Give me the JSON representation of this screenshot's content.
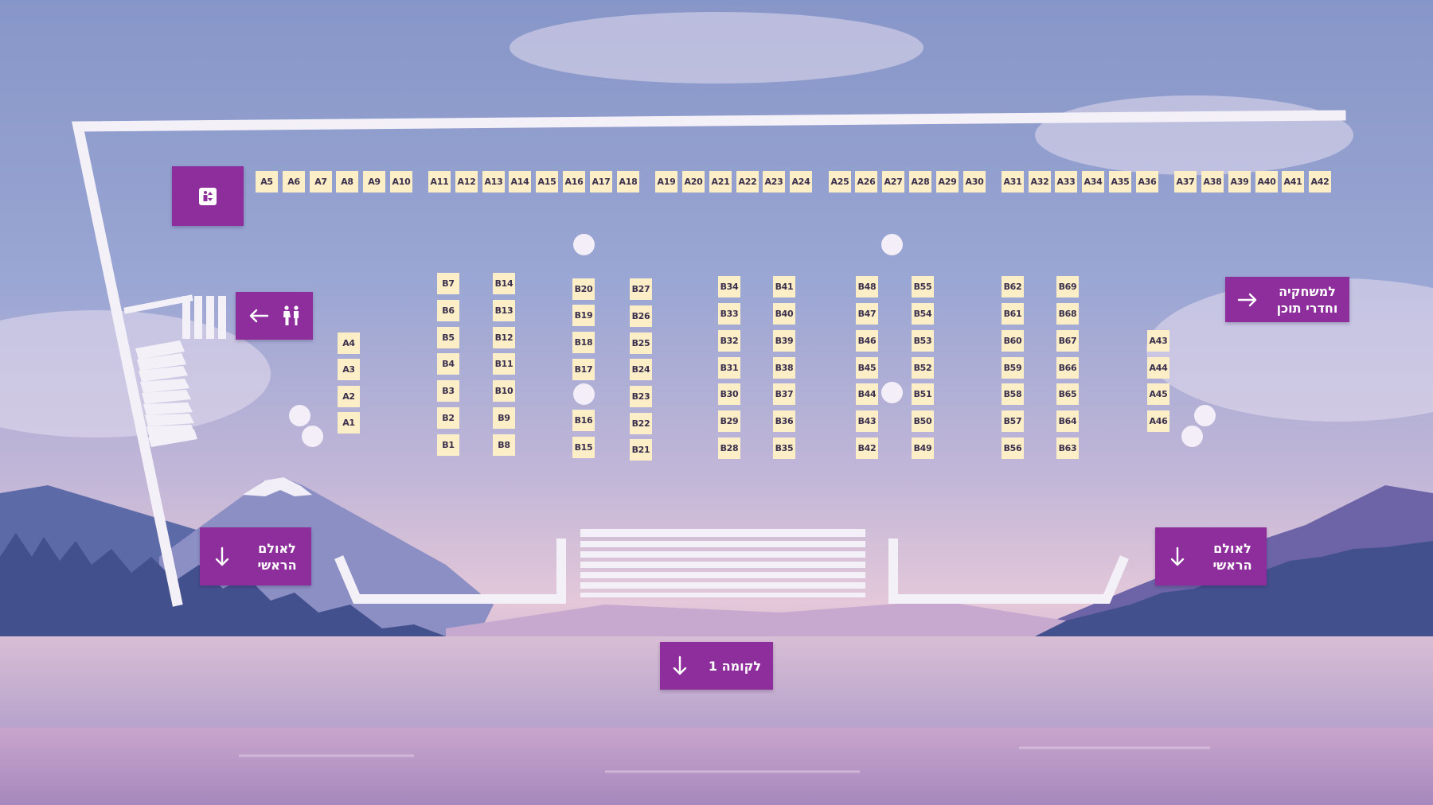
{
  "map": {
    "booths_row_a_top": [
      "A5",
      "A6",
      "A7",
      "A8",
      "A9",
      "A10",
      "A11",
      "A12",
      "A13",
      "A14",
      "A15",
      "A16",
      "A17",
      "A18",
      "A19",
      "A20",
      "A21",
      "A22",
      "A23",
      "A24",
      "A25",
      "A26",
      "A27",
      "A28",
      "A29",
      "A30",
      "A31",
      "A32",
      "A33",
      "A34",
      "A35",
      "A36",
      "A37",
      "A38",
      "A39",
      "A40",
      "A41",
      "A42"
    ],
    "booths_a_left": [
      "A4",
      "A3",
      "A2",
      "A1"
    ],
    "booths_a_right": [
      "A43",
      "A44",
      "A45",
      "A46"
    ],
    "booth_columns_b": [
      [
        "B7",
        "B6",
        "B5",
        "B4",
        "B3",
        "B2",
        "B1"
      ],
      [
        "B14",
        "B13",
        "B12",
        "B11",
        "B10",
        "B9",
        "B8"
      ],
      [
        "B20",
        "B19",
        "B18",
        "B17",
        "B16",
        "B15"
      ],
      [
        "B27",
        "B26",
        "B25",
        "B24",
        "B23",
        "B22",
        "B21"
      ],
      [
        "B34",
        "B33",
        "B32",
        "B31",
        "B30",
        "B29",
        "B28"
      ],
      [
        "B41",
        "B40",
        "B39",
        "B38",
        "B37",
        "B36",
        "B35"
      ],
      [
        "B48",
        "B47",
        "B46",
        "B45",
        "B44",
        "B43",
        "B42"
      ],
      [
        "B55",
        "B54",
        "B53",
        "B52",
        "B51",
        "B50",
        "B49"
      ],
      [
        "B62",
        "B61",
        "B60",
        "B59",
        "B58",
        "B57",
        "B56"
      ],
      [
        "B69",
        "B68",
        "B67",
        "B66",
        "B65",
        "B64",
        "B63"
      ]
    ],
    "signs": {
      "game_rooms": "למשחקיה\nוחדרי תוכן",
      "main_hall_left": "לאולם\nהראשי",
      "main_hall_right": "לאולם\nהראשי",
      "floor_1": "לקומה 1"
    },
    "icons": {
      "elevator": "elevator-icon",
      "restrooms": "restroom-icon",
      "arrow_left": "arrow-left-icon",
      "arrow_right": "arrow-right-icon",
      "arrow_down": "arrow-down-icon"
    },
    "colors": {
      "sign": "#8e2e9d",
      "booth": "#fcefc7",
      "booth_text": "#3a2f4d",
      "wall": "#f4f0f8"
    }
  }
}
